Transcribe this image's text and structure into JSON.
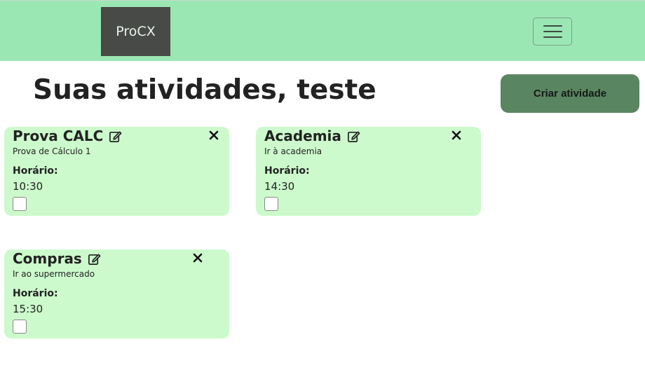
{
  "navbar": {
    "brand": "ProCX",
    "toggle_icon": "hamburger-menu-icon"
  },
  "header": {
    "title": "Suas atividades, teste",
    "create_label": "Criar atividade"
  },
  "colors": {
    "navbar_bg": "#9be7b4",
    "brand_bg": "#484a47",
    "card_bg": "#ccfacc",
    "button_bg": "#5a8561"
  },
  "activities": [
    {
      "title": "Prova CALC",
      "description": "Prova de Cálculo 1",
      "time_label": "Horário:",
      "time": "10:30",
      "done": false
    },
    {
      "title": "Academia",
      "description": "Ir à academia",
      "time_label": "Horário:",
      "time": "14:30",
      "done": false
    },
    {
      "title": "Compras",
      "description": "Ir ao supermercado",
      "time_label": "Horário:",
      "time": "15:30",
      "done": false
    }
  ]
}
